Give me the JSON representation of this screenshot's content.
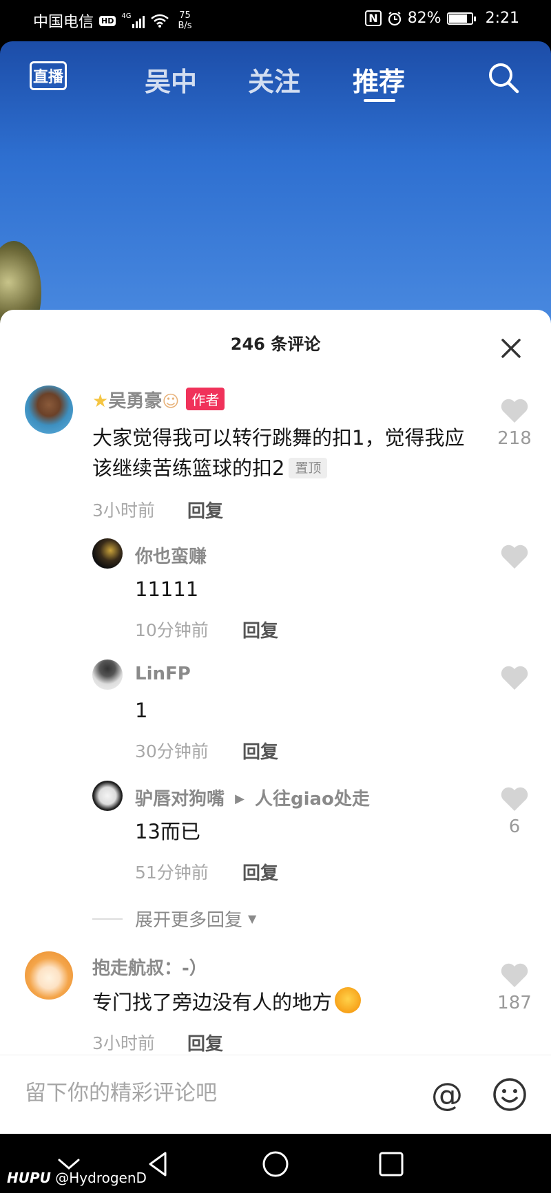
{
  "status_bar": {
    "carrier": "中国电信",
    "hd": "HD",
    "network": "4G",
    "speed_value": "75",
    "speed_unit": "B/s",
    "nfc": "N",
    "battery": "82%",
    "battery_level": 0.82,
    "time": "2:21"
  },
  "top_nav": {
    "live_label": "直播",
    "tabs": [
      {
        "label": "吴中",
        "active": false
      },
      {
        "label": "关注",
        "active": false
      },
      {
        "label": "推荐",
        "active": true
      }
    ]
  },
  "comments_panel": {
    "title": "246 条评论",
    "comments": [
      {
        "name": "吴勇豪",
        "author_tag": "作者",
        "text": "大家觉得我可以转行跳舞的扣1，觉得我应该继续苦练篮球的扣2",
        "pinned_tag": "置顶",
        "time": "3小时前",
        "reply_label": "回复",
        "likes": "218"
      },
      {
        "name": "你也蛮赚",
        "text": "11111",
        "time": "10分钟前",
        "reply_label": "回复",
        "likes": ""
      },
      {
        "name": "LinFP",
        "text": "1",
        "time": "30分钟前",
        "reply_label": "回复",
        "likes": ""
      },
      {
        "name": "驴唇对狗嘴",
        "reply_to": "人往giao处走",
        "text": "13而已",
        "time": "51分钟前",
        "reply_label": "回复",
        "likes": "6"
      },
      {
        "name": "抱走航叔：-）",
        "text": "专门找了旁边没有人的地方",
        "time": "3小时前",
        "reply_label": "回复",
        "likes": "187"
      }
    ],
    "expand_label": "展开更多回复"
  },
  "input_bar": {
    "placeholder": "留下你的精彩评论吧",
    "at_symbol": "@"
  },
  "watermark": {
    "brand": "HUPU",
    "handle": "@HydrogenD"
  },
  "colors": {
    "author_tag": "#f0325a",
    "sky": "#2e6fd0"
  },
  "icons": [
    "search-icon",
    "close-icon",
    "heart-icon",
    "at-icon",
    "emoji-icon",
    "back-icon",
    "home-icon",
    "recents-icon",
    "collapse-icon"
  ]
}
